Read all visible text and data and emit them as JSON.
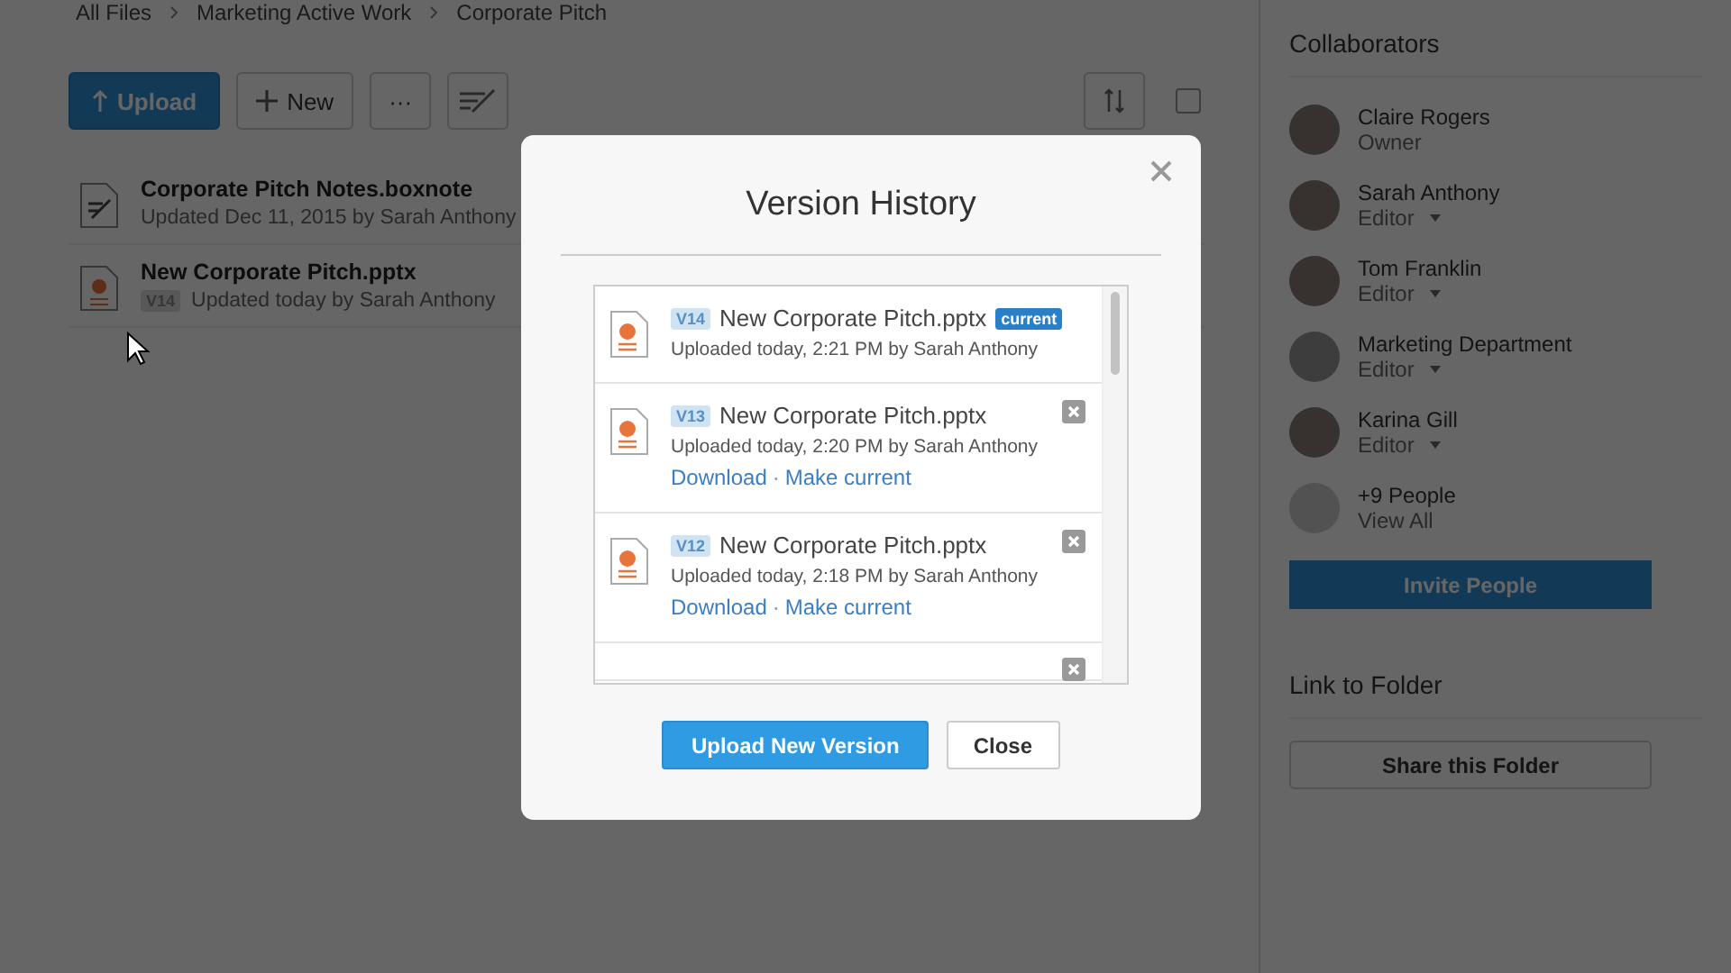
{
  "breadcrumb": [
    "All Files",
    "Marketing Active Work",
    "Corporate Pitch"
  ],
  "toolbar": {
    "upload": "Upload",
    "new": "New",
    "more": "···",
    "select_all": {
      "checked": false
    }
  },
  "files": [
    {
      "kind": "note",
      "name": "Corporate Pitch Notes.boxnote",
      "meta": "Updated Dec 11, 2015 by Sarah Anthony"
    },
    {
      "kind": "pptx",
      "name": "New Corporate Pitch.pptx",
      "version": "V14",
      "meta": "Updated today by Sarah Anthony"
    }
  ],
  "sidebar": {
    "title": "Collaborators",
    "collaborators": [
      {
        "kind": "person",
        "name": "Claire Rogers",
        "role": "Owner",
        "role_menu": false
      },
      {
        "kind": "person",
        "name": "Sarah Anthony",
        "role": "Editor",
        "role_menu": true
      },
      {
        "kind": "person",
        "name": "Tom Franklin",
        "role": "Editor",
        "role_menu": true
      },
      {
        "kind": "group",
        "name": "Marketing Department",
        "role": "Editor",
        "role_menu": true
      },
      {
        "kind": "person",
        "name": "Karina Gill",
        "role": "Editor",
        "role_menu": true
      },
      {
        "kind": "more",
        "name": "+9 People",
        "role": "View All",
        "role_menu": false
      }
    ],
    "invite": "Invite People",
    "link_title": "Link to Folder",
    "share": "Share this Folder"
  },
  "dialog": {
    "title": "Version History",
    "versions": [
      {
        "version": "V14",
        "name": "New Corporate Pitch.pptx",
        "current": true,
        "badge": "current",
        "meta": "Uploaded today, 2:21 PM by Sarah Anthony"
      },
      {
        "version": "V13",
        "name": "New Corporate Pitch.pptx",
        "current": false,
        "meta": "Uploaded today, 2:20 PM by Sarah Anthony",
        "download": "Download",
        "separator": "·",
        "make_current": "Make current"
      },
      {
        "version": "V12",
        "name": "New Corporate Pitch.pptx",
        "current": false,
        "meta": "Uploaded today, 2:18 PM by Sarah Anthony",
        "download": "Download",
        "separator": "·",
        "make_current": "Make current"
      }
    ],
    "primary": "Upload New Version",
    "secondary": "Close"
  }
}
